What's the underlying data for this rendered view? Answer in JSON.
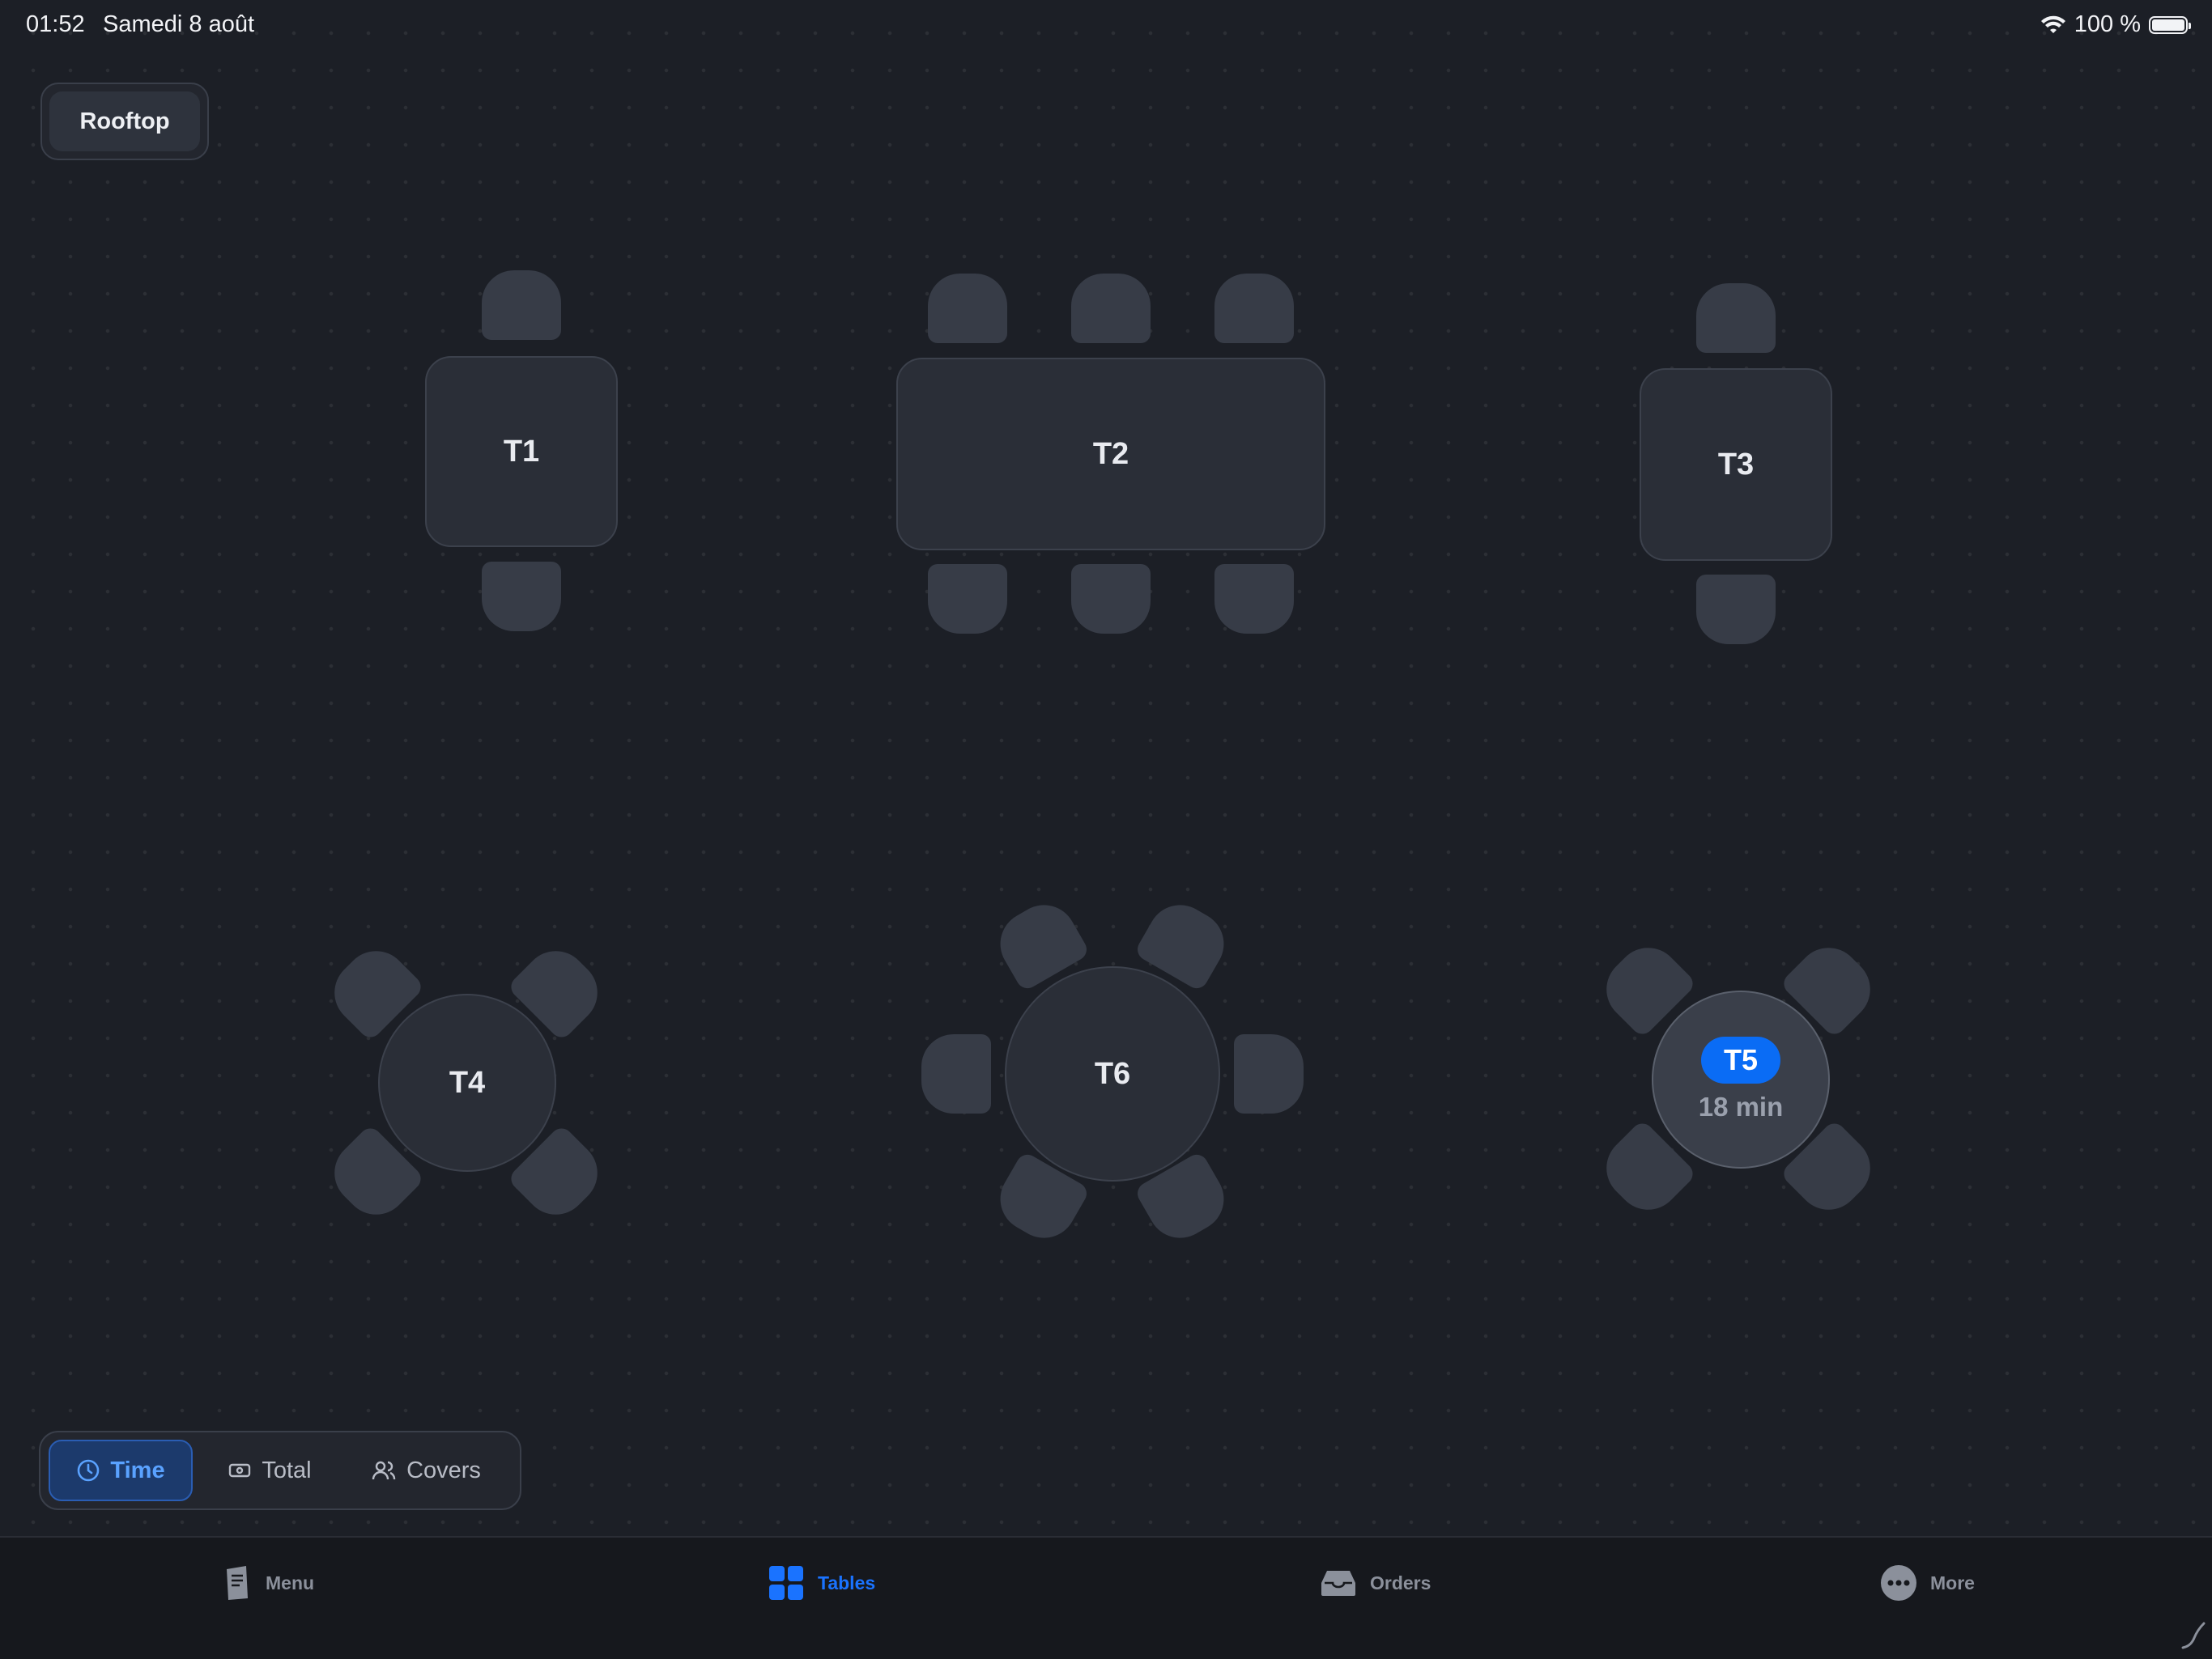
{
  "status": {
    "time": "01:52",
    "date": "Samedi 8 août",
    "battery": "100 %",
    "icons": [
      "wifi-icon",
      "battery-icon"
    ]
  },
  "area": {
    "name": "Rooftop"
  },
  "tables": [
    {
      "id": "T1",
      "label": "T1"
    },
    {
      "id": "T2",
      "label": "T2"
    },
    {
      "id": "T3",
      "label": "T3"
    },
    {
      "id": "T4",
      "label": "T4"
    },
    {
      "id": "T5",
      "label": "T5",
      "active": true,
      "elapsed": "18 min"
    },
    {
      "id": "T6",
      "label": "T6"
    }
  ],
  "display_mode": {
    "selected": "Time",
    "options": [
      {
        "label": "Time",
        "icon": "clock-icon"
      },
      {
        "label": "Total",
        "icon": "cash-icon"
      },
      {
        "label": "Covers",
        "icon": "people-icon"
      }
    ]
  },
  "tabbar": {
    "active": "Tables",
    "items": [
      {
        "label": "Menu",
        "icon": "menu-book-icon"
      },
      {
        "label": "Tables",
        "icon": "grid-icon"
      },
      {
        "label": "Orders",
        "icon": "inbox-tray-icon"
      },
      {
        "label": "More",
        "icon": "more-dots-icon"
      }
    ]
  },
  "colors": {
    "accent": "#0a6cf5",
    "background": "#1c1f26",
    "table": "#2a2e37",
    "seat": "#373c47"
  }
}
